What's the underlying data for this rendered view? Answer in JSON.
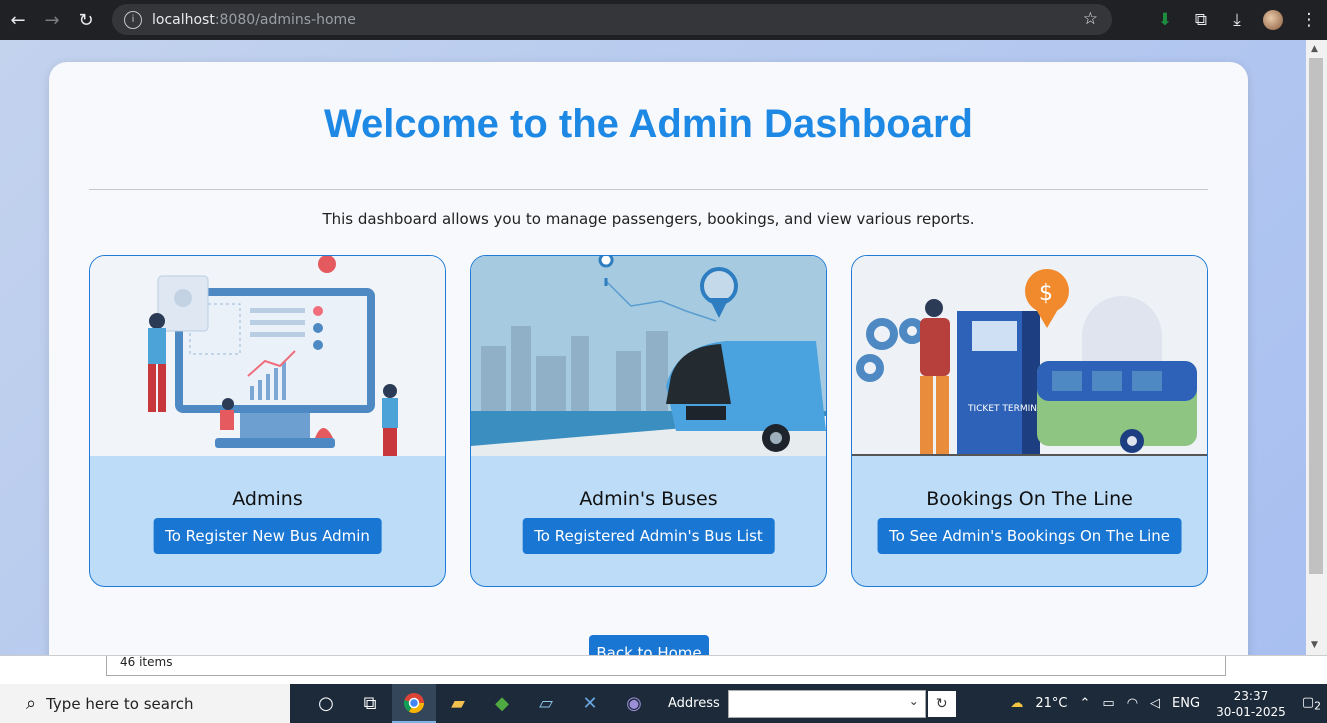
{
  "browser": {
    "url_host": "localhost",
    "url_path": ":8080/admins-home"
  },
  "page": {
    "title": "Welcome to the Admin Dashboard",
    "subtitle": "This dashboard allows you to manage passengers, bookings, and view various reports.",
    "cards": [
      {
        "label": "Admins",
        "button": "To Register New Bus Admin"
      },
      {
        "label": "Admin's Buses",
        "button": "To Registered Admin's Bus List"
      },
      {
        "label": "Bookings On The Line",
        "button": "To See Admin's Bookings On The Line"
      }
    ],
    "back_button": "Back to Home",
    "ticket_text": "TICKET TERMINAL"
  },
  "explorer": {
    "items_count": "46 items"
  },
  "taskbar": {
    "search_placeholder": "Type here to search",
    "address_label": "Address",
    "weather": "21°C",
    "language": "ENG",
    "time": "23:37",
    "date": "30-01-2025",
    "notification_count": "2"
  },
  "colors": {
    "accent": "#1e88e5",
    "button": "#1976d2",
    "card_bg": "#bcdcf8"
  }
}
